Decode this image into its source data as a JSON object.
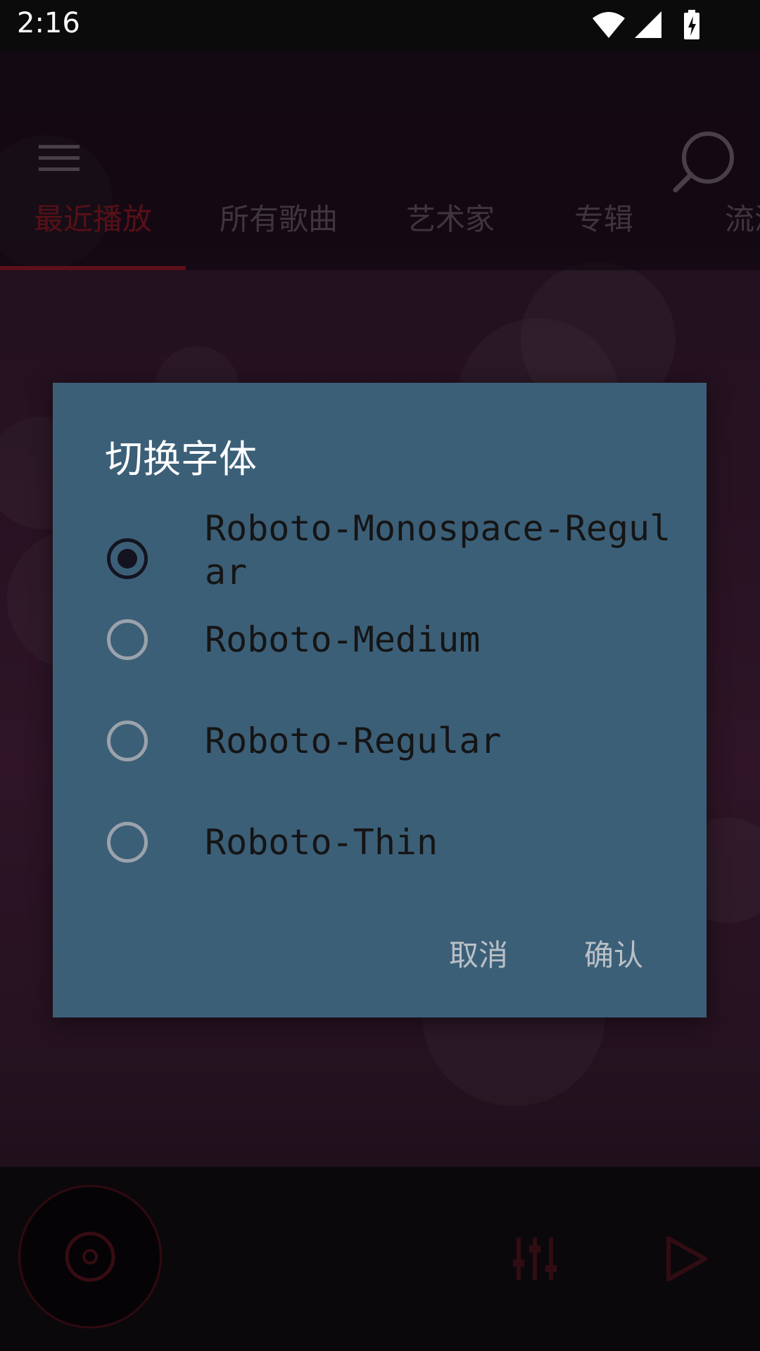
{
  "status_bar": {
    "time": "2:16",
    "icons": [
      "wifi-icon",
      "signal-icon",
      "battery-charging-icon"
    ]
  },
  "top_bar": {
    "menu_icon": "hamburger-menu-icon",
    "search_icon": "search-icon"
  },
  "tabs": [
    {
      "label": "最近播放",
      "active": true
    },
    {
      "label": "所有歌曲",
      "active": false
    },
    {
      "label": "艺术家",
      "active": false
    },
    {
      "label": "专辑",
      "active": false
    },
    {
      "label": "流派",
      "active": false
    }
  ],
  "dialog": {
    "title": "切换字体",
    "options": [
      {
        "label": "Roboto-Monospace-Regular",
        "checked": true
      },
      {
        "label": "Roboto-Medium",
        "checked": false
      },
      {
        "label": "Roboto-Regular",
        "checked": false
      },
      {
        "label": "Roboto-Thin",
        "checked": false
      }
    ],
    "cancel_label": "取消",
    "confirm_label": "确认"
  },
  "player": {
    "disc_icon": "disc-icon",
    "equalizer_icon": "equalizer-icon",
    "play_icon": "play-icon"
  },
  "colors": {
    "accent": "#b0202f",
    "dialog_bg": "#3c5f78",
    "tab_inactive": "#7a6777"
  }
}
